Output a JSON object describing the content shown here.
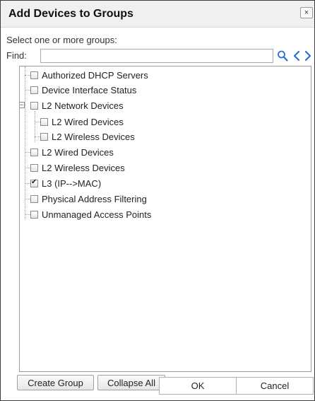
{
  "dialog": {
    "title": "Add Devices to Groups",
    "close_label": "×"
  },
  "prompt": "Select one or more groups:",
  "find": {
    "label": "Find:",
    "value": "",
    "placeholder": ""
  },
  "tree": {
    "items": [
      {
        "label": "Authorized DHCP Servers",
        "checked": false,
        "level": 0
      },
      {
        "label": "Device Interface Status",
        "checked": false,
        "level": 0
      },
      {
        "label": "L2 Network Devices",
        "checked": false,
        "level": 0,
        "expanded": true
      },
      {
        "label": "L2 Wired Devices",
        "checked": false,
        "level": 1
      },
      {
        "label": "L2 Wireless Devices",
        "checked": false,
        "level": 1
      },
      {
        "label": "L2 Wired Devices",
        "checked": false,
        "level": 0
      },
      {
        "label": "L2 Wireless Devices",
        "checked": false,
        "level": 0
      },
      {
        "label": "L3 (IP-->MAC)",
        "checked": true,
        "level": 0
      },
      {
        "label": "Physical Address Filtering",
        "checked": false,
        "level": 0
      },
      {
        "label": "Unmanaged Access Points",
        "checked": false,
        "level": 0
      }
    ],
    "expander_symbol": "−"
  },
  "buttons": {
    "create_group": "Create Group",
    "collapse_all": "Collapse All",
    "ok": "OK",
    "cancel": "Cancel"
  },
  "colors": {
    "accent_icon": "#2a6fd6",
    "border": "#3c3c3c"
  }
}
